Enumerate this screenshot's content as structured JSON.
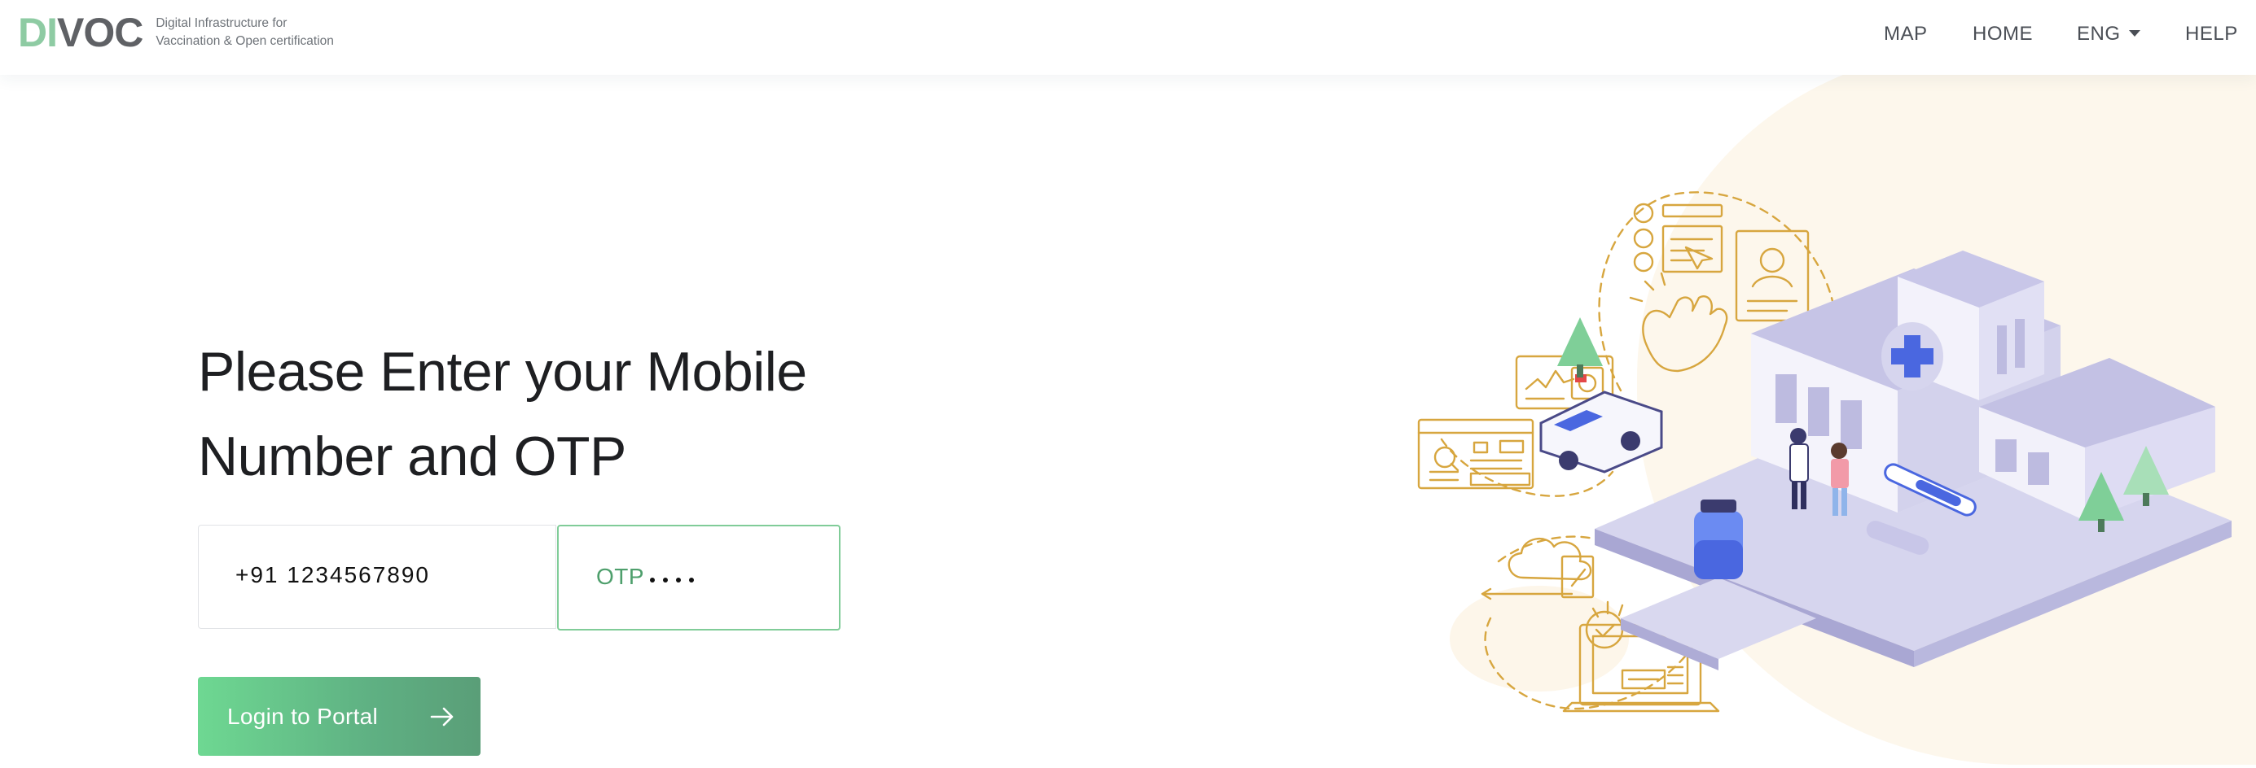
{
  "header": {
    "logo": {
      "part1": "DI",
      "part2": "VOC",
      "tagline_line1": "Digital Infrastructure for",
      "tagline_line2": "Vaccination & Open certification"
    },
    "nav": [
      {
        "label": "MAP"
      },
      {
        "label": "HOME"
      },
      {
        "label": "ENG",
        "has_dropdown": true
      },
      {
        "label": "HELP"
      }
    ]
  },
  "main": {
    "title": "Please Enter your Mobile Number and OTP",
    "mobile_input": {
      "value": "+91 1234567890"
    },
    "otp_input": {
      "label": "OTP",
      "masked_length": 4
    },
    "login_button": {
      "label": "Login to Portal",
      "icon": "arrow-right-icon"
    }
  },
  "colors": {
    "logo_accent": "#8ecba3",
    "logo_dark": "#5f6165",
    "primary_green": "#5fb183",
    "otp_border": "#80cc98",
    "illustration_gold": "#d7a63f",
    "illustration_lavender": "#c9c8e6"
  },
  "illustration": {
    "name": "healthcare-vaccination-illustration"
  }
}
